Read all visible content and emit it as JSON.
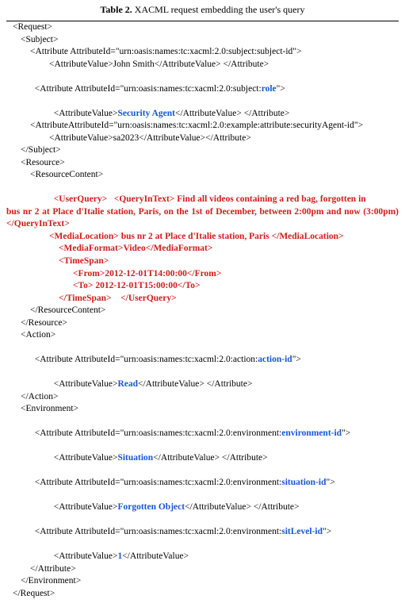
{
  "caption": {
    "label": "Table 2.",
    "text": "XACML request embedding the user's query"
  },
  "xml": {
    "request_open": "<Request>",
    "subject_open": "<Subject>",
    "subj_attr1_open": "<Attribute AttributeId=\"urn:oasis:names:tc:xacml:2.0:subject:subject-id\">",
    "subj_attr1_val": "<AttributeValue>John Smith</AttributeValue> </Attribute>",
    "subj_attr2_pre": "<Attribute AttributeId=\"urn:oasis:names:tc:xacml:2.0:subject:",
    "role_kw": "role",
    "subj_attr2_post": "\">",
    "subj_attr2_val_pre": "<AttributeValue>",
    "security_agent": "Security Agent",
    "subj_attr2_val_post": "</AttributeValue> </Attribute>",
    "subj_attr3_open": "<AttributeAttributeId=\"urn:oasis:names:tc:xacml:2.0:example:attribute:securityAgent-id\">",
    "subj_attr3_val": "<AttributeValue>sa2023</AttributeValue></Attribute>",
    "subject_close": "</Subject>",
    "resource_open": "<Resource>",
    "rescontent_open": "<ResourceContent>",
    "uq_tag_open": "<UserQuery>",
    "qit_open": "<QueryInText>",
    "qit_text_head": " Find all videos containing a red bag, forgotten in",
    "qit_text_body": "bus nr 2 at Place d'Italie station, Paris, on the 1st of December, between 2:00pm and now (3:00pm)</QueryInText>",
    "ml": "<MediaLocation> bus nr 2 at Place d'Italie station, Paris </MediaLocation>",
    "mf": "<MediaFormat>Video</MediaFormat>",
    "ts_open": "<TimeSpan>",
    "ts_from": "<From>2012-12-01T14:00:00</From>",
    "ts_to": "<To> 2012-12-01T15:00:00</To>",
    "ts_close_and_uq": "</TimeSpan>    </UserQuery>",
    "rescontent_close": "</ResourceContent>",
    "resource_close": "</Resource>",
    "action_open": "<Action>",
    "action_attr_pre": "<Attribute AttributeId=\"urn:oasis:names:tc:xacml:2.0:action:",
    "action_id_kw": "action-id",
    "action_attr_post": "\">",
    "action_val_pre": "<AttributeValue>",
    "read_kw": "Read",
    "action_val_post": "</AttributeValue> </Attribute>",
    "action_close": "</Action>",
    "env_open": "<Environment>",
    "env_attr1_pre": "<Attribute AttributeId=\"urn:oasis:names:tc:xacml:2.0:environment:",
    "env_id_kw": "environment-id",
    "env_attr1_post": "\">",
    "env_val1_pre": "<AttributeValue>",
    "situation_kw": "Situation",
    "env_val1_post": "</AttributeValue> </Attribute>",
    "env_attr2_pre": "<Attribute AttributeId=\"urn:oasis:names:tc:xacml:2.0:environment:",
    "situation_id_kw": "situation-id",
    "env_attr2_post": "\">",
    "env_val2_pre": "<AttributeValue>",
    "forgotten_kw": "Forgotten Object",
    "env_val2_post": "</AttributeValue> </Attribute>",
    "env_attr3_pre": "<Attribute AttributeId=\"urn:oasis:names:tc:xacml:2.0:environment:",
    "sitlevel_kw": "sitLevel-id",
    "env_attr3_post": "\">",
    "env_val3_pre": "<AttributeValue>",
    "one_kw": "1",
    "env_val3_post": "</AttributeValue>",
    "attr_close": "</Attribute>",
    "env_close": "</Environment>",
    "request_close": "</Request>"
  }
}
